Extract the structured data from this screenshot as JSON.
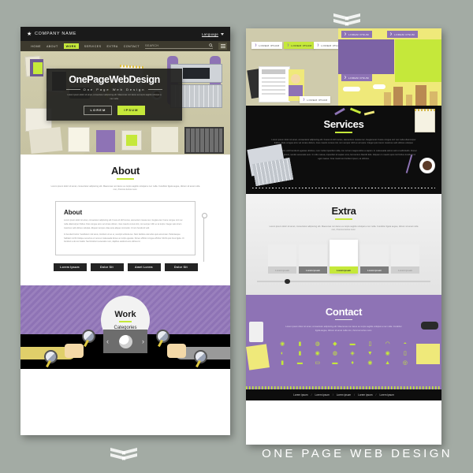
{
  "poster": {
    "caption": "ONE PAGE WEB DESIGN"
  },
  "left_page": {
    "topbar": {
      "brand": "COMPANY NAME",
      "star_icon": "star-icon",
      "language": "Language",
      "caret_icon": "chevron-down-icon"
    },
    "nav": {
      "items": [
        {
          "label": "HOME",
          "active": false
        },
        {
          "label": "ABOUT",
          "active": false
        },
        {
          "label": "WORK",
          "active": true
        },
        {
          "label": "SERVICES",
          "active": false
        },
        {
          "label": "EXTRA",
          "active": false
        },
        {
          "label": "CONTACT",
          "active": false
        }
      ],
      "search_placeholder": "SEARCH",
      "search_icon": "search-icon",
      "menu_icon": "hamburger-icon"
    },
    "hero": {
      "title": "OnePageWebDesign",
      "subtitle": "One Page Web Design",
      "paragraph": "Lorem ipsum dolor sit amet, consectetur adipiscing elit. Maecenas non lacus eu turpis sagittis volutpat a nec nulla.",
      "button_primary": "LOREM",
      "button_secondary": "IPSUM"
    },
    "about": {
      "title": "About",
      "lead": "Lorem ipsum dolor sit amet, consectetur adipiscing elit. Maecenas non lacus eu turpis sagittis volutpat a nec nulla. Curabitur ligula augue, dictum sit amet nulla non, rhoncus luctus nunc.",
      "box_title": "About",
      "box_paragraph_1": "Lorem ipsum dolor sit amet, consectetur adipiscing elit. Fusce id nibh luctus, elementum massa nec, feugiat erat. Fusce congue orci nec nulla ullamcorper finibus. Duis congue arcu vel ornare dictum, risus mauris cursus nisl, non semper nibh ex at turpis. Integer quis lorem maximus velit ultrices volutpat. Aliquam tempus vitae ante aliquet commodo. Ut non hendrerit velit.",
      "box_paragraph_2": "In hendrerit tortor. Vestibulum nisl lacus, tincidunt ut leo et, suscipit vehicula leo. Nam facilisis erat tellus quis accumsan. Pellentesque habitant morbi tristique senectus et netus et malesuada fames ac turpis egestas. Donec efficitur congue efficitur. Morbi quis risus ligula. Ut tincidunt a dui vel mattis. Sed tincidunt venenatis nunc, dapibus eleifend eros ultrices id.",
      "buttons": [
        "Lorem Ipsum",
        "Dolor Sit",
        "Amet Lorem",
        "Dolor Sit"
      ]
    },
    "work": {
      "title": "Work",
      "subtitle": "Categories",
      "prev_icon": "chevron-left-icon",
      "next_icon": "chevron-right-icon",
      "globe_icon": "globe-icon",
      "magnifier_icon": "magnifier-icon"
    }
  },
  "right_page": {
    "top_tags": [
      "LOREM IPSUM",
      "LOREM IPSUM",
      "LOREM IPSUM",
      "LOREM IPSUM",
      "LOREM IPSUM",
      "LOREM IPSUM",
      "LOREM IPSUM",
      "LOREM IPSUM"
    ],
    "services": {
      "title": "Services",
      "lead": "Lorem ipsum dolor sit amet, consectetur adipiscing elit. Fusce id nibh luctus, elementum massa nec, feugiat erat. Fusce congue orci nec nulla ullamcorper finibus. Duis congue arcu vel ornare dictum, risus mauris cursus nisl, non semper nibh ex at turpis. Integer quis lorem maximus velit ultrices volutpat.",
      "paragraph": "Aliquam lobortis velit hendrerit egestas ultricies, nunc nulla imperdiet nulla, non rutrum magna tellus a sapien. In malesuada varius velit ut sollicitudin. Donec in imperdiet ipsum, iaculis venenatis sem. In odio massa, imperdiet sit sapien eros, fermentum blandit felis. Aliquam in mauris quis nisl finibus tincidunt id eget massa. Cras maximus tincidunt ipsum, at ultricies."
    },
    "extra": {
      "title": "Extra",
      "lead": "Lorem ipsum dolor sit amet, consectetur adipiscing elit. Maecenas non lacus eu turpis sagittis volutpat a nec nulla. Curabitur ligula augue, dictum sit amet nulla non, rhoncus luctus nunc.",
      "cards": [
        "Lorem ipsum",
        "Lorem ipsum",
        "Lorem ipsum",
        "Lorem ipsum",
        "Lorem ipsum"
      ],
      "active_card_index": 2
    },
    "contact": {
      "title": "Contact",
      "lead": "Lorem ipsum dolor sit amet, consectetur adipiscing elit. Maecenas non lacus eu turpis sagittis volutpat a nec nulla. Curabitur ligula augue, dictum sit amet nulla non, rhoncus luctus nunc.",
      "icons": [
        "eye-icon",
        "lock-icon",
        "pin-icon",
        "droplet-icon",
        "mail-icon",
        "key-icon",
        "umbrella-icon",
        "bell-icon",
        "speaker-icon",
        "pen-icon",
        "lightbulb-icon",
        "globe-icon",
        "arrows-icon",
        "flag-icon",
        "user-icon",
        "lock-alt-icon",
        "book-icon",
        "briefcase-icon",
        "monitor-icon",
        "camera-icon",
        "map-pin-icon",
        "clock-icon",
        "alert-icon",
        "target-icon"
      ]
    },
    "footer": {
      "links": [
        "Lorem ipsum",
        "Lorem ipsum",
        "Lorem ipsum",
        "Lorem ipsum",
        "Lorem ipsum"
      ],
      "separator": "/"
    }
  },
  "colors": {
    "accent_green": "#c5e83a",
    "purple": "#8e73b5",
    "dark": "#0d0d0d",
    "desk": "#cfcbac",
    "background": "#a3aba4"
  }
}
